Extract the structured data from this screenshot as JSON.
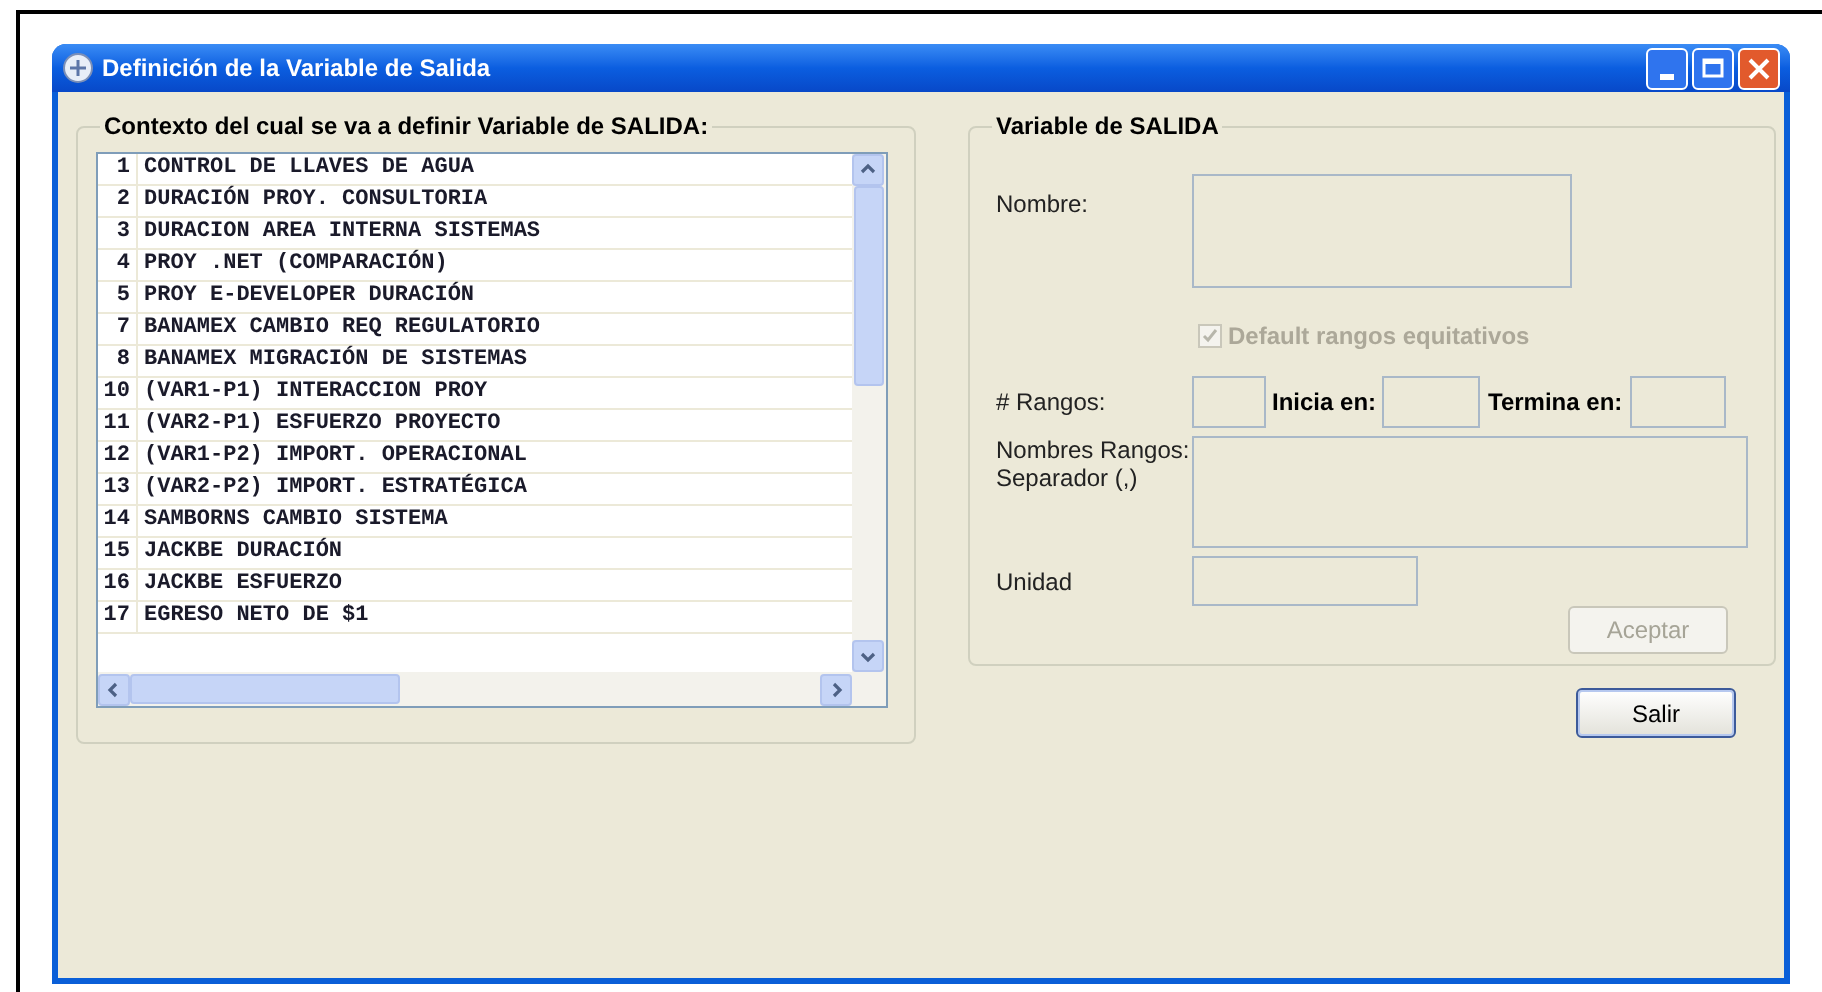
{
  "window": {
    "title": "Definición de la Variable de Salida"
  },
  "context_group": {
    "title": "Contexto del cual se va a definir Variable de SALIDA:",
    "items": [
      {
        "number": "1",
        "name": "CONTROL DE LLAVES DE AGUA"
      },
      {
        "number": "2",
        "name": "DURACIÓN PROY. CONSULTORIA"
      },
      {
        "number": "3",
        "name": "DURACION AREA INTERNA SISTEMAS"
      },
      {
        "number": "4",
        "name": "PROY .NET (COMPARACIÓN)"
      },
      {
        "number": "5",
        "name": "PROY E-DEVELOPER DURACIÓN"
      },
      {
        "number": "7",
        "name": "BANAMEX CAMBIO REQ REGULATORIO"
      },
      {
        "number": "8",
        "name": "BANAMEX MIGRACIÓN DE SISTEMAS"
      },
      {
        "number": "10",
        "name": "(VAR1-P1) INTERACCION PROY"
      },
      {
        "number": "11",
        "name": "(VAR2-P1) ESFUERZO PROYECTO"
      },
      {
        "number": "12",
        "name": "(VAR1-P2) IMPORT. OPERACIONAL"
      },
      {
        "number": "13",
        "name": "(VAR2-P2) IMPORT. ESTRATÉGICA"
      },
      {
        "number": "14",
        "name": "SAMBORNS CAMBIO SISTEMA"
      },
      {
        "number": "15",
        "name": "JACKBE DURACIÓN"
      },
      {
        "number": "16",
        "name": "JACKBE ESFUERZO"
      },
      {
        "number": "17",
        "name": "EGRESO NETO DE $1"
      }
    ]
  },
  "output_group": {
    "title": "Variable de SALIDA",
    "name_label": "Nombre:",
    "default_checkbox": {
      "label": "Default rangos equitativos",
      "checked": true,
      "disabled": true
    },
    "ranges_label": "# Rangos:",
    "start_label": "Inicia en:",
    "end_label": "Termina en:",
    "range_names_label": "Nombres Rangos: Separador  (,)",
    "unit_label": "Unidad",
    "accept_button": {
      "label": "Aceptar",
      "disabled": true
    }
  },
  "exit_button": {
    "label": "Salir",
    "disabled": false
  }
}
